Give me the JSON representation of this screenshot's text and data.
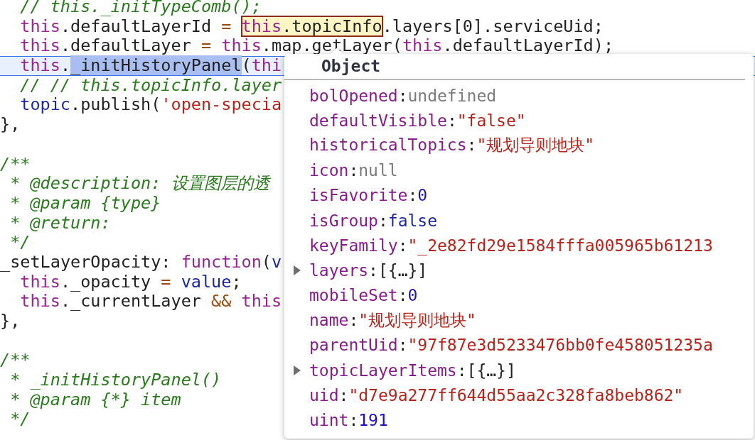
{
  "code": {
    "lines": [
      {
        "kind": "code",
        "indent": true,
        "current": false,
        "tokens": [
          {
            "t": "// this._initTypeComb();",
            "kind": "cmt"
          }
        ]
      },
      {
        "kind": "code",
        "indent": true,
        "current": false,
        "tokens": [
          {
            "t": "this",
            "kind": "kw"
          },
          {
            "t": ".defaultLayerId ",
            "kind": "plain"
          },
          {
            "t": "= ",
            "kind": "op"
          },
          {
            "kind": "inspect",
            "parts": [
              {
                "t": "this",
                "kind": "kw"
              },
              {
                "t": ".topicInfo",
                "kind": "plain"
              }
            ]
          },
          {
            "t": ".layers[0].serviceUid;",
            "kind": "plain"
          }
        ]
      },
      {
        "kind": "code",
        "indent": true,
        "current": false,
        "tokens": [
          {
            "t": "this",
            "kind": "kw"
          },
          {
            "t": ".defaultLayer ",
            "kind": "plain"
          },
          {
            "t": "= ",
            "kind": "op"
          },
          {
            "t": "this",
            "kind": "kw"
          },
          {
            "t": ".map.getLayer(",
            "kind": "plain"
          },
          {
            "t": "this",
            "kind": "kw"
          },
          {
            "t": ".defaultLayerId);",
            "kind": "plain"
          }
        ]
      },
      {
        "kind": "code",
        "indent": true,
        "current": true,
        "tokens": [
          {
            "t": "this",
            "kind": "kw"
          },
          {
            "t": ".",
            "kind": "plain"
          },
          {
            "t": "_initHistoryPanel",
            "kind": "select"
          },
          {
            "t": "(",
            "kind": "plain"
          },
          {
            "t": "thi",
            "kind": "kw"
          }
        ]
      },
      {
        "kind": "code",
        "indent": true,
        "current": false,
        "tokens": [
          {
            "t": "// // this.topicInfo.layer",
            "kind": "cmt"
          }
        ]
      },
      {
        "kind": "code",
        "indent": true,
        "current": false,
        "tokens": [
          {
            "t": "topic",
            "kind": "var"
          },
          {
            "t": ".publish(",
            "kind": "plain"
          },
          {
            "t": "'open-specia",
            "kind": "str"
          }
        ]
      },
      {
        "kind": "code",
        "indent": false,
        "current": false,
        "tokens": [
          {
            "t": "},",
            "kind": "plain"
          }
        ]
      },
      {
        "kind": "blank"
      },
      {
        "kind": "code",
        "indent": false,
        "current": false,
        "tokens": [
          {
            "t": "/**",
            "kind": "cmt"
          }
        ]
      },
      {
        "kind": "code",
        "indent": false,
        "current": false,
        "tokens": [
          {
            "t": " * @description: 设置图层的透",
            "kind": "cmt"
          }
        ]
      },
      {
        "kind": "code",
        "indent": false,
        "current": false,
        "tokens": [
          {
            "t": " * @param {type}",
            "kind": "cmt"
          }
        ]
      },
      {
        "kind": "code",
        "indent": false,
        "current": false,
        "tokens": [
          {
            "t": " * @return:",
            "kind": "cmt"
          }
        ]
      },
      {
        "kind": "code",
        "indent": false,
        "current": false,
        "tokens": [
          {
            "t": " */",
            "kind": "cmt"
          }
        ]
      },
      {
        "kind": "code",
        "indent": false,
        "current": false,
        "tokens": [
          {
            "t": "_setLayerOpacity: ",
            "kind": "plain"
          },
          {
            "t": "function",
            "kind": "kw"
          },
          {
            "t": "(",
            "kind": "plain"
          },
          {
            "t": "v",
            "kind": "var"
          }
        ]
      },
      {
        "kind": "code",
        "indent": true,
        "current": false,
        "tokens": [
          {
            "t": "this",
            "kind": "kw"
          },
          {
            "t": "._opacity ",
            "kind": "plain"
          },
          {
            "t": "= ",
            "kind": "op"
          },
          {
            "t": "value",
            "kind": "var"
          },
          {
            "t": ";",
            "kind": "plain"
          }
        ]
      },
      {
        "kind": "code",
        "indent": true,
        "current": false,
        "tokens": [
          {
            "t": "this",
            "kind": "kw"
          },
          {
            "t": "._currentLayer ",
            "kind": "plain"
          },
          {
            "t": "&& ",
            "kind": "op"
          },
          {
            "t": "this",
            "kind": "kw"
          }
        ]
      },
      {
        "kind": "code",
        "indent": false,
        "current": false,
        "tokens": [
          {
            "t": "},",
            "kind": "plain"
          }
        ]
      },
      {
        "kind": "blank"
      },
      {
        "kind": "code",
        "indent": false,
        "current": false,
        "tokens": [
          {
            "t": "/**",
            "kind": "cmt"
          }
        ]
      },
      {
        "kind": "code",
        "indent": false,
        "current": false,
        "tokens": [
          {
            "t": " * _initHistoryPanel()",
            "kind": "cmt"
          }
        ]
      },
      {
        "kind": "code",
        "indent": false,
        "current": false,
        "tokens": [
          {
            "t": " * @param {*} item",
            "kind": "cmt"
          }
        ]
      },
      {
        "kind": "code",
        "indent": false,
        "current": false,
        "tokens": [
          {
            "t": " */",
            "kind": "cmt"
          }
        ]
      }
    ]
  },
  "popover": {
    "title": "Object",
    "properties": [
      {
        "key": "bolOpened:",
        "value": "undefined",
        "kind": "undefined",
        "expandable": false
      },
      {
        "key": "defaultVisible:",
        "value": "\"false\"",
        "kind": "string",
        "expandable": false
      },
      {
        "key": "historicalTopics:",
        "value": "\"规划导则地块\"",
        "kind": "string",
        "expandable": false
      },
      {
        "key": "icon:",
        "value": "null",
        "kind": "null",
        "expandable": false
      },
      {
        "key": "isFavorite:",
        "value": "0",
        "kind": "number",
        "expandable": false
      },
      {
        "key": "isGroup:",
        "value": "false",
        "kind": "boolean",
        "expandable": false
      },
      {
        "key": "keyFamily:",
        "value": "\"_2e82fd29e1584fffa005965b61213",
        "kind": "string",
        "expandable": false
      },
      {
        "key": "layers:",
        "value": "[{…}]",
        "kind": "array",
        "expandable": true
      },
      {
        "key": "mobileSet:",
        "value": "0",
        "kind": "number",
        "expandable": false
      },
      {
        "key": "name:",
        "value": "\"规划导则地块\"",
        "kind": "string",
        "expandable": false
      },
      {
        "key": "parentUid:",
        "value": "\"97f87e3d5233476bb0fe458051235a",
        "kind": "string",
        "expandable": false
      },
      {
        "key": "topicLayerItems:",
        "value": "[{…}]",
        "kind": "array",
        "expandable": true
      },
      {
        "key": "uid:",
        "value": "\"d7e9a277ff644d55aa2c328fa8beb862\"",
        "kind": "string",
        "expandable": false
      },
      {
        "key": "uint:",
        "value": "191",
        "kind": "number",
        "expandable": false
      }
    ]
  }
}
